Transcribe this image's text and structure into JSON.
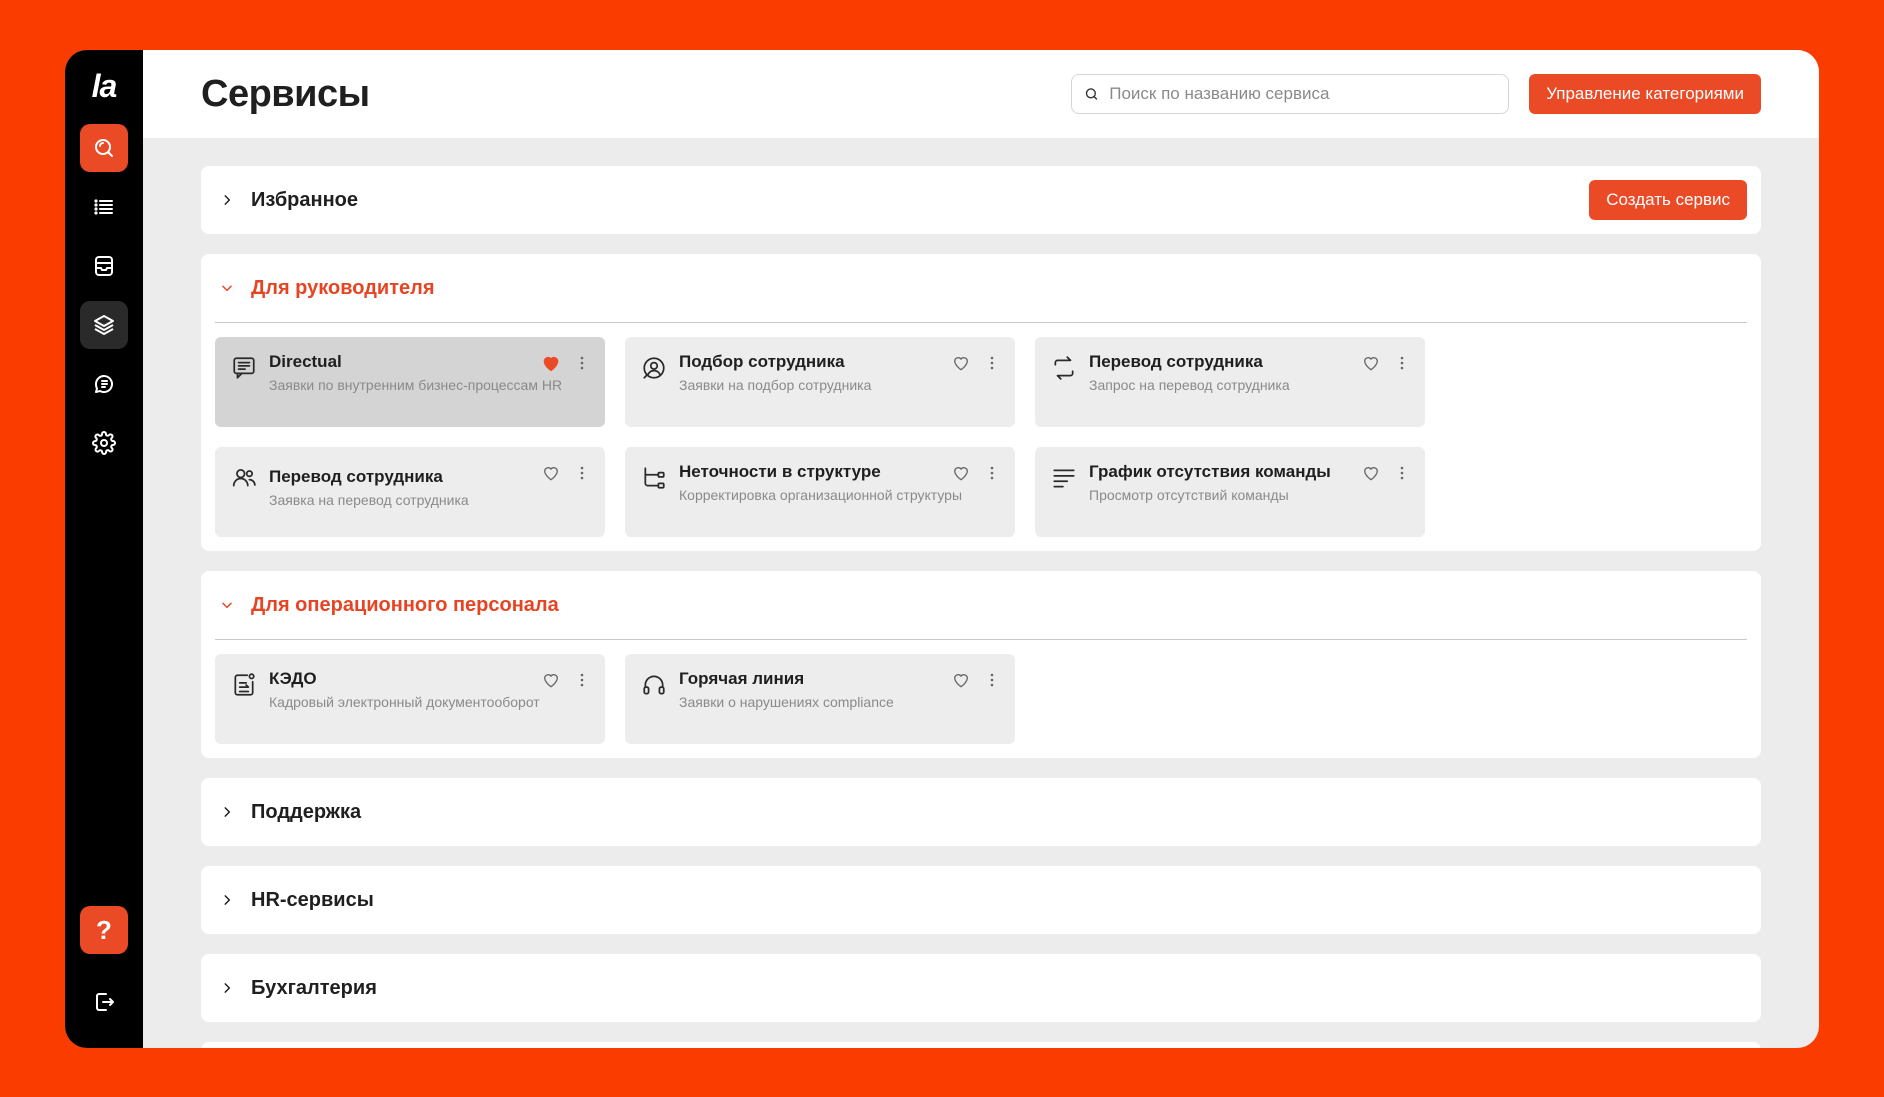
{
  "app": {
    "logo": "la",
    "title": "Сервисы"
  },
  "search": {
    "placeholder": "Поиск по названию сервиса"
  },
  "header": {
    "manage_categories": "Управление категориями"
  },
  "sidebar": {
    "items": [
      {
        "icon": "search-icon",
        "active": true
      },
      {
        "icon": "list-icon"
      },
      {
        "icon": "inbox-icon"
      },
      {
        "icon": "layers-icon",
        "hover": true
      },
      {
        "icon": "chat-icon"
      },
      {
        "icon": "gear-icon"
      }
    ],
    "help": "?",
    "logout_icon": "logout-icon"
  },
  "categories": {
    "favorites": {
      "title": "Избранное",
      "create_button": "Создать сервис"
    },
    "managers": {
      "title": "Для руководителя",
      "cards": [
        {
          "title": "Directual",
          "subtitle": "Заявки по внутренним бизнес-процессам HR",
          "icon": "document-list-icon",
          "favorite": true
        },
        {
          "title": "Подбор сотрудника",
          "subtitle": "Заявки на подбор сотрудника",
          "icon": "user-search-icon",
          "favorite": false
        },
        {
          "title": "Перевод сотрудника",
          "subtitle": "Запрос на перевод сотрудника",
          "icon": "transfer-icon",
          "favorite": false
        },
        {
          "title": "Перевод сотрудника",
          "subtitle": "Заявка на перевод сотрудника",
          "icon": "users-icon",
          "favorite": false
        },
        {
          "title": "Неточности в структуре",
          "subtitle": "Корректировка организационной структуры",
          "icon": "structure-icon",
          "favorite": false
        },
        {
          "title": "График отсутствия команды",
          "subtitle": "Просмотр отсутствий команды",
          "icon": "lines-icon",
          "favorite": false
        }
      ]
    },
    "operational": {
      "title": "Для операционного персонала",
      "cards": [
        {
          "title": "КЭДО",
          "subtitle": "Кадровый электронный документооборот",
          "icon": "edoc-icon",
          "favorite": false
        },
        {
          "title": "Горячая линия",
          "subtitle": "Заявки о нарушениях compliance",
          "icon": "headset-icon",
          "favorite": false
        }
      ]
    },
    "support": {
      "title": "Поддержка"
    },
    "hr": {
      "title": "HR-сервисы"
    },
    "accounting": {
      "title": "Бухгалтерия"
    }
  },
  "colors": {
    "accent": "#EB4A26",
    "background": "#FA3C00",
    "sidebar": "#000000"
  }
}
